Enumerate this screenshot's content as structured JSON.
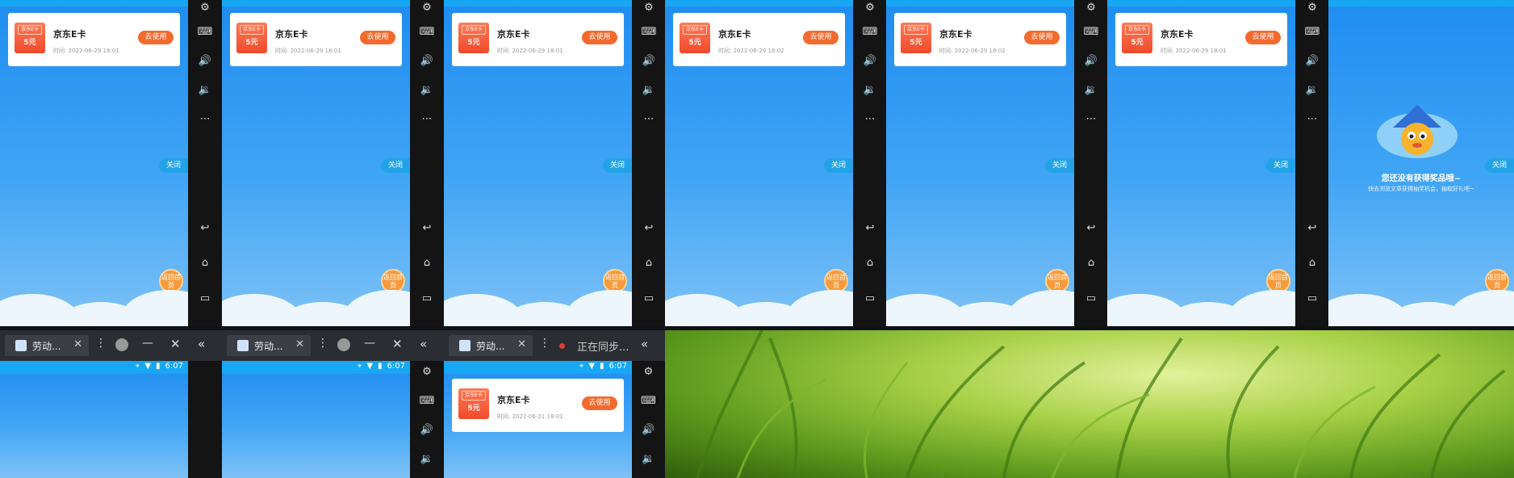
{
  "top_row": {
    "coupon_title": "京东E卡",
    "coupon_tag": "京东E卡",
    "coupon_amount": "5元",
    "use_button": "去使用",
    "close_label": "关闭",
    "home_label": "返回首页",
    "times": [
      "时间: 2022-06-29 18:01",
      "时间: 2022-06-29 18:01",
      "时间: 2022-06-29 18:01",
      "时间: 2022-06-29 18:02",
      "时间: 2022-06-29 18:02",
      "时间: 2022-06-29 18:01"
    ],
    "empty_title": "您还没有获得奖品哦~",
    "empty_subtitle": "快去浏览文章获得抽奖机会，抽取好礼吧~"
  },
  "side_panel_icons": [
    "settings-icon",
    "keyboard-icon",
    "volume-up-icon",
    "volume-down-icon",
    "more-icon",
    "back-icon",
    "home-icon",
    "recents-icon"
  ],
  "bottom_row": {
    "tab_title": "劳动...",
    "sync_text": "正在同步...",
    "status_time": "6:07",
    "coupon_time": "时间: 2022-06-21 18:01"
  },
  "colors": {
    "accent_orange": "#f26a2e",
    "sky_blue": "#1e8df0",
    "status_cyan": "#17a7f3"
  }
}
